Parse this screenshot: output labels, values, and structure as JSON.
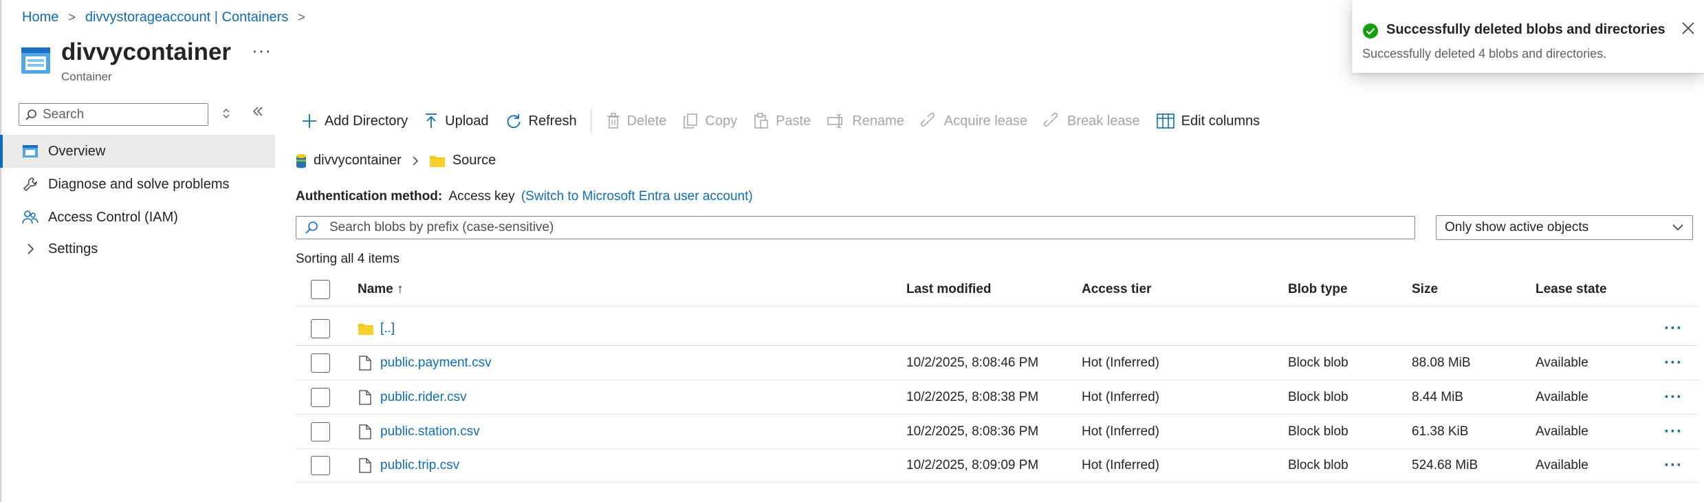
{
  "breadcrumb": {
    "home": "Home",
    "account": "divvystorageaccount | Containers",
    "sep": ">"
  },
  "header": {
    "title": "divvycontainer",
    "subtitle": "Container",
    "more": "···"
  },
  "sidebar": {
    "search_placeholder": "Search",
    "items": [
      {
        "label": "Overview",
        "icon": "overview-icon",
        "active": true
      },
      {
        "label": "Diagnose and solve problems",
        "icon": "wrench-icon"
      },
      {
        "label": "Access Control (IAM)",
        "icon": "people-icon"
      },
      {
        "label": "Settings",
        "icon": "chevron-right-icon"
      }
    ]
  },
  "toolbar": {
    "add_directory": "Add Directory",
    "upload": "Upload",
    "refresh": "Refresh",
    "delete": "Delete",
    "copy": "Copy",
    "paste": "Paste",
    "rename": "Rename",
    "acquire_lease": "Acquire lease",
    "break_lease": "Break lease",
    "edit_columns": "Edit columns"
  },
  "path": {
    "container": "divvycontainer",
    "folder": "Source"
  },
  "auth": {
    "label": "Authentication method:",
    "value": "Access key",
    "switch_link": "(Switch to Microsoft Entra user account)"
  },
  "blob_search": {
    "placeholder": "Search blobs by prefix (case-sensitive)"
  },
  "filter": {
    "selected": "Only show active objects"
  },
  "sorting_text": "Sorting all 4 items",
  "table": {
    "headers": {
      "name": "Name ↑",
      "last_modified": "Last modified",
      "access_tier": "Access tier",
      "blob_type": "Blob type",
      "size": "Size",
      "lease_state": "Lease state"
    },
    "parent": "[..]",
    "rows": [
      {
        "name": "public.payment.csv",
        "last_modified": "10/2/2025, 8:08:46 PM",
        "access_tier": "Hot (Inferred)",
        "blob_type": "Block blob",
        "size": "88.08 MiB",
        "lease_state": "Available"
      },
      {
        "name": "public.rider.csv",
        "last_modified": "10/2/2025, 8:08:38 PM",
        "access_tier": "Hot (Inferred)",
        "blob_type": "Block blob",
        "size": "8.44 MiB",
        "lease_state": "Available"
      },
      {
        "name": "public.station.csv",
        "last_modified": "10/2/2025, 8:08:36 PM",
        "access_tier": "Hot (Inferred)",
        "blob_type": "Block blob",
        "size": "61.38 KiB",
        "lease_state": "Available"
      },
      {
        "name": "public.trip.csv",
        "last_modified": "10/2/2025, 8:09:09 PM",
        "access_tier": "Hot (Inferred)",
        "blob_type": "Block blob",
        "size": "524.68 MiB",
        "lease_state": "Available"
      }
    ],
    "row_more": "···"
  },
  "toast": {
    "title": "Successfully deleted blobs and directories",
    "message": "Successfully deleted 4 blobs and directories."
  },
  "colors": {
    "accent": "#0f6cbd",
    "success": "#13a10e",
    "folder": "#f2c811"
  }
}
